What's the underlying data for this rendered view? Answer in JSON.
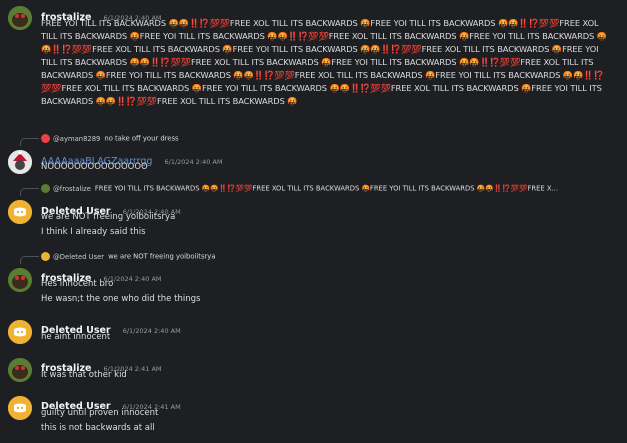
{
  "messages": {
    "m1": {
      "author": "frostalize",
      "timestamp": "6/1/2024 2:40 AM",
      "text": "FREE YOI TILL ITS BACKWARDS 🤬🤬‼️⁉️💯💯FREE XOL TILL ITS BACKWARDS 🤬FREE YOI TILL ITS BACKWARDS 🤬🤬‼️⁉️💯💯FREE XOL TILL ITS BACKWARDS 🤬FREE YOI TILL ITS BACKWARDS 🤬🤬‼️⁉️💯💯FREE XOL TILL ITS BACKWARDS 🤬FREE YOI TILL ITS BACKWARDS 🤬🤬‼️⁉️💯💯FREE XOL TILL ITS BACKWARDS 🤬FREE YOI TILL ITS BACKWARDS 🤬🤬‼️⁉️💯💯FREE XOL TILL ITS BACKWARDS 🤬FREE YOI TILL ITS BACKWARDS 🤬🤬‼️⁉️💯💯FREE XOL TILL ITS BACKWARDS 🤬FREE YOI TILL ITS BACKWARDS 🤬🤬‼️⁉️💯💯FREE XOL TILL ITS BACKWARDS 🤬FREE YOI TILL ITS BACKWARDS 🤬🤬‼️⁉️💯💯FREE XOL TILL ITS BACKWARDS 🤬FREE YOI TILL ITS BACKWARDS 🤬🤬‼️⁉️💯💯FREE XOL TILL ITS BACKWARDS 🤬FREE YOI TILL ITS BACKWARDS 🤬🤬‼️⁉️💯💯FREE XOL TILL ITS BACKWARDS 🤬FREE YOI TILL ITS BACKWARDS 🤬🤬‼️⁉️💯💯FREE XOL TILL ITS BACKWARDS 🤬"
    },
    "m2": {
      "reply_to_name": "@ayman8289",
      "reply_to_text": "no take off your dress",
      "author": "AAAAaaaBLAGZaarrrgg",
      "timestamp": "6/1/2024 2:40 AM",
      "lines": [
        "NOOOOOOOOOOOOOOO"
      ]
    },
    "m3": {
      "reply_to_name": "@frostalize",
      "reply_to_text": "FREE YOI TILL ITS BACKWARDS 🤬🤬‼️⁉️💯💯FREE XOL TILL ITS BACKWARDS 🤬FREE YOI TILL ITS BACKWARDS 🤬🤬‼️⁉️💯💯FREE X...",
      "author": "Deleted User",
      "timestamp": "6/1/2024 2:40 AM",
      "lines": [
        "we are NOT freeing yoiboiitsrya",
        "I think I already said this"
      ]
    },
    "m4": {
      "reply_to_name": "@Deleted User",
      "reply_to_text": "we are NOT freeing yoiboiitsrya",
      "author": "frostalize",
      "timestamp": "6/1/2024 2:40 AM",
      "lines": [
        "Hes innocent bro",
        "He wasn;t the one who did the things"
      ]
    },
    "m5": {
      "author": "Deleted User",
      "timestamp": "6/1/2024 2:40 AM",
      "lines": [
        "he aint innocent"
      ]
    },
    "m6": {
      "author": "frostalize",
      "timestamp": "6/1/2024 2:41 AM",
      "lines": [
        "It was that other kid"
      ]
    },
    "m7": {
      "author": "Deleted User",
      "timestamp": "6/1/2024 2:41 AM",
      "lines": [
        "guilty until proven innocent",
        "this is not backwards at all"
      ]
    }
  },
  "colors": {
    "background": "#1e1f22",
    "username": "#f2f3f5",
    "username_blue": "#5f8fe0",
    "timestamp": "#949ba4",
    "text": "#dbdee1",
    "discord_avatar": "#f0b232"
  },
  "icons": {
    "frost_avatar": "frog-avatar-icon",
    "deleted_avatar": "discord-logo-icon",
    "aaa_avatar": "santa-avatar-icon"
  }
}
